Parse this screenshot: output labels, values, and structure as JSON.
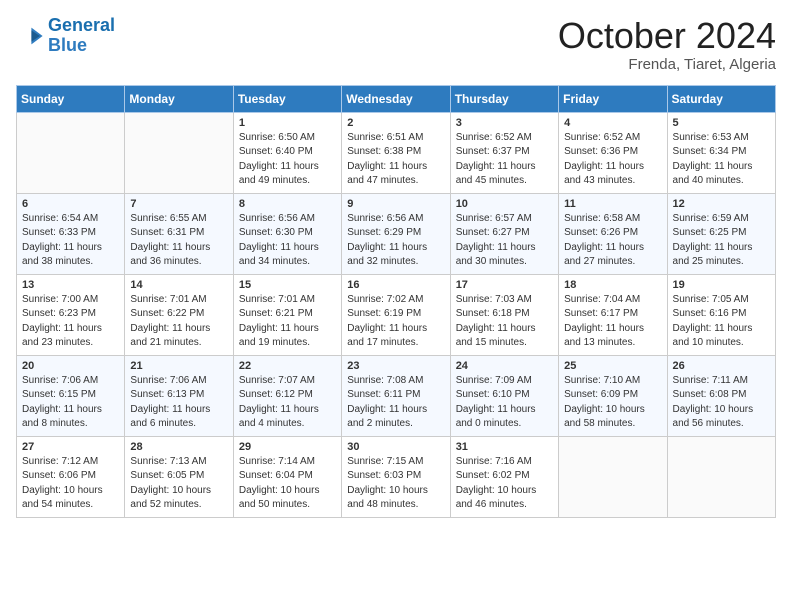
{
  "header": {
    "logo_line1": "General",
    "logo_line2": "Blue",
    "month": "October 2024",
    "location": "Frenda, Tiaret, Algeria"
  },
  "weekdays": [
    "Sunday",
    "Monday",
    "Tuesday",
    "Wednesday",
    "Thursday",
    "Friday",
    "Saturday"
  ],
  "weeks": [
    [
      {
        "day": "",
        "text": ""
      },
      {
        "day": "",
        "text": ""
      },
      {
        "day": "1",
        "text": "Sunrise: 6:50 AM\nSunset: 6:40 PM\nDaylight: 11 hours and 49 minutes."
      },
      {
        "day": "2",
        "text": "Sunrise: 6:51 AM\nSunset: 6:38 PM\nDaylight: 11 hours and 47 minutes."
      },
      {
        "day": "3",
        "text": "Sunrise: 6:52 AM\nSunset: 6:37 PM\nDaylight: 11 hours and 45 minutes."
      },
      {
        "day": "4",
        "text": "Sunrise: 6:52 AM\nSunset: 6:36 PM\nDaylight: 11 hours and 43 minutes."
      },
      {
        "day": "5",
        "text": "Sunrise: 6:53 AM\nSunset: 6:34 PM\nDaylight: 11 hours and 40 minutes."
      }
    ],
    [
      {
        "day": "6",
        "text": "Sunrise: 6:54 AM\nSunset: 6:33 PM\nDaylight: 11 hours and 38 minutes."
      },
      {
        "day": "7",
        "text": "Sunrise: 6:55 AM\nSunset: 6:31 PM\nDaylight: 11 hours and 36 minutes."
      },
      {
        "day": "8",
        "text": "Sunrise: 6:56 AM\nSunset: 6:30 PM\nDaylight: 11 hours and 34 minutes."
      },
      {
        "day": "9",
        "text": "Sunrise: 6:56 AM\nSunset: 6:29 PM\nDaylight: 11 hours and 32 minutes."
      },
      {
        "day": "10",
        "text": "Sunrise: 6:57 AM\nSunset: 6:27 PM\nDaylight: 11 hours and 30 minutes."
      },
      {
        "day": "11",
        "text": "Sunrise: 6:58 AM\nSunset: 6:26 PM\nDaylight: 11 hours and 27 minutes."
      },
      {
        "day": "12",
        "text": "Sunrise: 6:59 AM\nSunset: 6:25 PM\nDaylight: 11 hours and 25 minutes."
      }
    ],
    [
      {
        "day": "13",
        "text": "Sunrise: 7:00 AM\nSunset: 6:23 PM\nDaylight: 11 hours and 23 minutes."
      },
      {
        "day": "14",
        "text": "Sunrise: 7:01 AM\nSunset: 6:22 PM\nDaylight: 11 hours and 21 minutes."
      },
      {
        "day": "15",
        "text": "Sunrise: 7:01 AM\nSunset: 6:21 PM\nDaylight: 11 hours and 19 minutes."
      },
      {
        "day": "16",
        "text": "Sunrise: 7:02 AM\nSunset: 6:19 PM\nDaylight: 11 hours and 17 minutes."
      },
      {
        "day": "17",
        "text": "Sunrise: 7:03 AM\nSunset: 6:18 PM\nDaylight: 11 hours and 15 minutes."
      },
      {
        "day": "18",
        "text": "Sunrise: 7:04 AM\nSunset: 6:17 PM\nDaylight: 11 hours and 13 minutes."
      },
      {
        "day": "19",
        "text": "Sunrise: 7:05 AM\nSunset: 6:16 PM\nDaylight: 11 hours and 10 minutes."
      }
    ],
    [
      {
        "day": "20",
        "text": "Sunrise: 7:06 AM\nSunset: 6:15 PM\nDaylight: 11 hours and 8 minutes."
      },
      {
        "day": "21",
        "text": "Sunrise: 7:06 AM\nSunset: 6:13 PM\nDaylight: 11 hours and 6 minutes."
      },
      {
        "day": "22",
        "text": "Sunrise: 7:07 AM\nSunset: 6:12 PM\nDaylight: 11 hours and 4 minutes."
      },
      {
        "day": "23",
        "text": "Sunrise: 7:08 AM\nSunset: 6:11 PM\nDaylight: 11 hours and 2 minutes."
      },
      {
        "day": "24",
        "text": "Sunrise: 7:09 AM\nSunset: 6:10 PM\nDaylight: 11 hours and 0 minutes."
      },
      {
        "day": "25",
        "text": "Sunrise: 7:10 AM\nSunset: 6:09 PM\nDaylight: 10 hours and 58 minutes."
      },
      {
        "day": "26",
        "text": "Sunrise: 7:11 AM\nSunset: 6:08 PM\nDaylight: 10 hours and 56 minutes."
      }
    ],
    [
      {
        "day": "27",
        "text": "Sunrise: 7:12 AM\nSunset: 6:06 PM\nDaylight: 10 hours and 54 minutes."
      },
      {
        "day": "28",
        "text": "Sunrise: 7:13 AM\nSunset: 6:05 PM\nDaylight: 10 hours and 52 minutes."
      },
      {
        "day": "29",
        "text": "Sunrise: 7:14 AM\nSunset: 6:04 PM\nDaylight: 10 hours and 50 minutes."
      },
      {
        "day": "30",
        "text": "Sunrise: 7:15 AM\nSunset: 6:03 PM\nDaylight: 10 hours and 48 minutes."
      },
      {
        "day": "31",
        "text": "Sunrise: 7:16 AM\nSunset: 6:02 PM\nDaylight: 10 hours and 46 minutes."
      },
      {
        "day": "",
        "text": ""
      },
      {
        "day": "",
        "text": ""
      }
    ]
  ]
}
